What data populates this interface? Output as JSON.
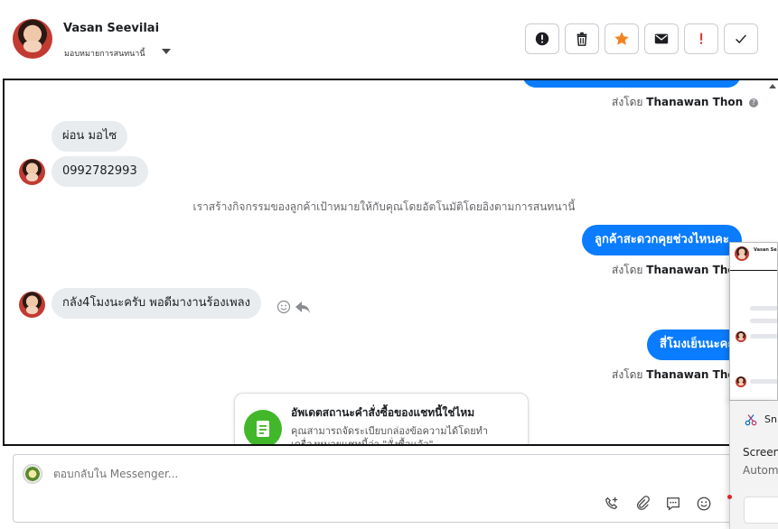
{
  "header": {
    "name": "Vasan Seevilai",
    "assign_label": "มอบหมายการสนทนานี้",
    "toolbar": [
      {
        "icon": "alert-circle-icon",
        "color": "#1c1e21"
      },
      {
        "icon": "trash-icon",
        "color": "#1c1e21"
      },
      {
        "icon": "star-icon",
        "color": "#f5821f"
      },
      {
        "icon": "envelope-icon",
        "color": "#1c1e21"
      },
      {
        "icon": "exclamation-icon",
        "color": "#e0302b"
      },
      {
        "icon": "checkmark-icon",
        "color": "#1c1e21"
      }
    ]
  },
  "chat": {
    "sent_prefix": "ส่งโดย",
    "agent_name": "Thanawan Thon",
    "msg_in_1": "ผ่อน มอไซ",
    "msg_in_2": "0992782993",
    "system_note": "เราสร้างกิจกรรมของลูกค้าเป้าหมายให้กับคุณโดยอัตโนมัติโดยอิงตามการสนทนานี้",
    "msg_out_1": "ลูกค้าสะดวกคุยช่วงไหนคะ",
    "msg_in_3": "กลัง4โมงนะครับ พอดีมางานร้องเพลง",
    "msg_out_2": "สี่โมงเย็นนะคะ",
    "card_title": "อัพเดตสถานะคำสั่งซื้อของแชทนี้ใช่ไหม",
    "card_body": "คุณสามารถจัดระเบียบกล่องข้อความได้โดยทำเครื่องหมายแชทนี้ว่า \"สั่งซื้อแล้ว\""
  },
  "reply": {
    "placeholder": "ตอบกลับใน Messenger..."
  },
  "overlay": {
    "thumb_name": "Vasan Se",
    "snip_title": "Sni",
    "snip_line1": "Screen",
    "snip_line2": "Autom"
  },
  "colors": {
    "accent": "#0a7cff",
    "incoming": "#e9ecef",
    "card_icon": "#42b72a"
  }
}
